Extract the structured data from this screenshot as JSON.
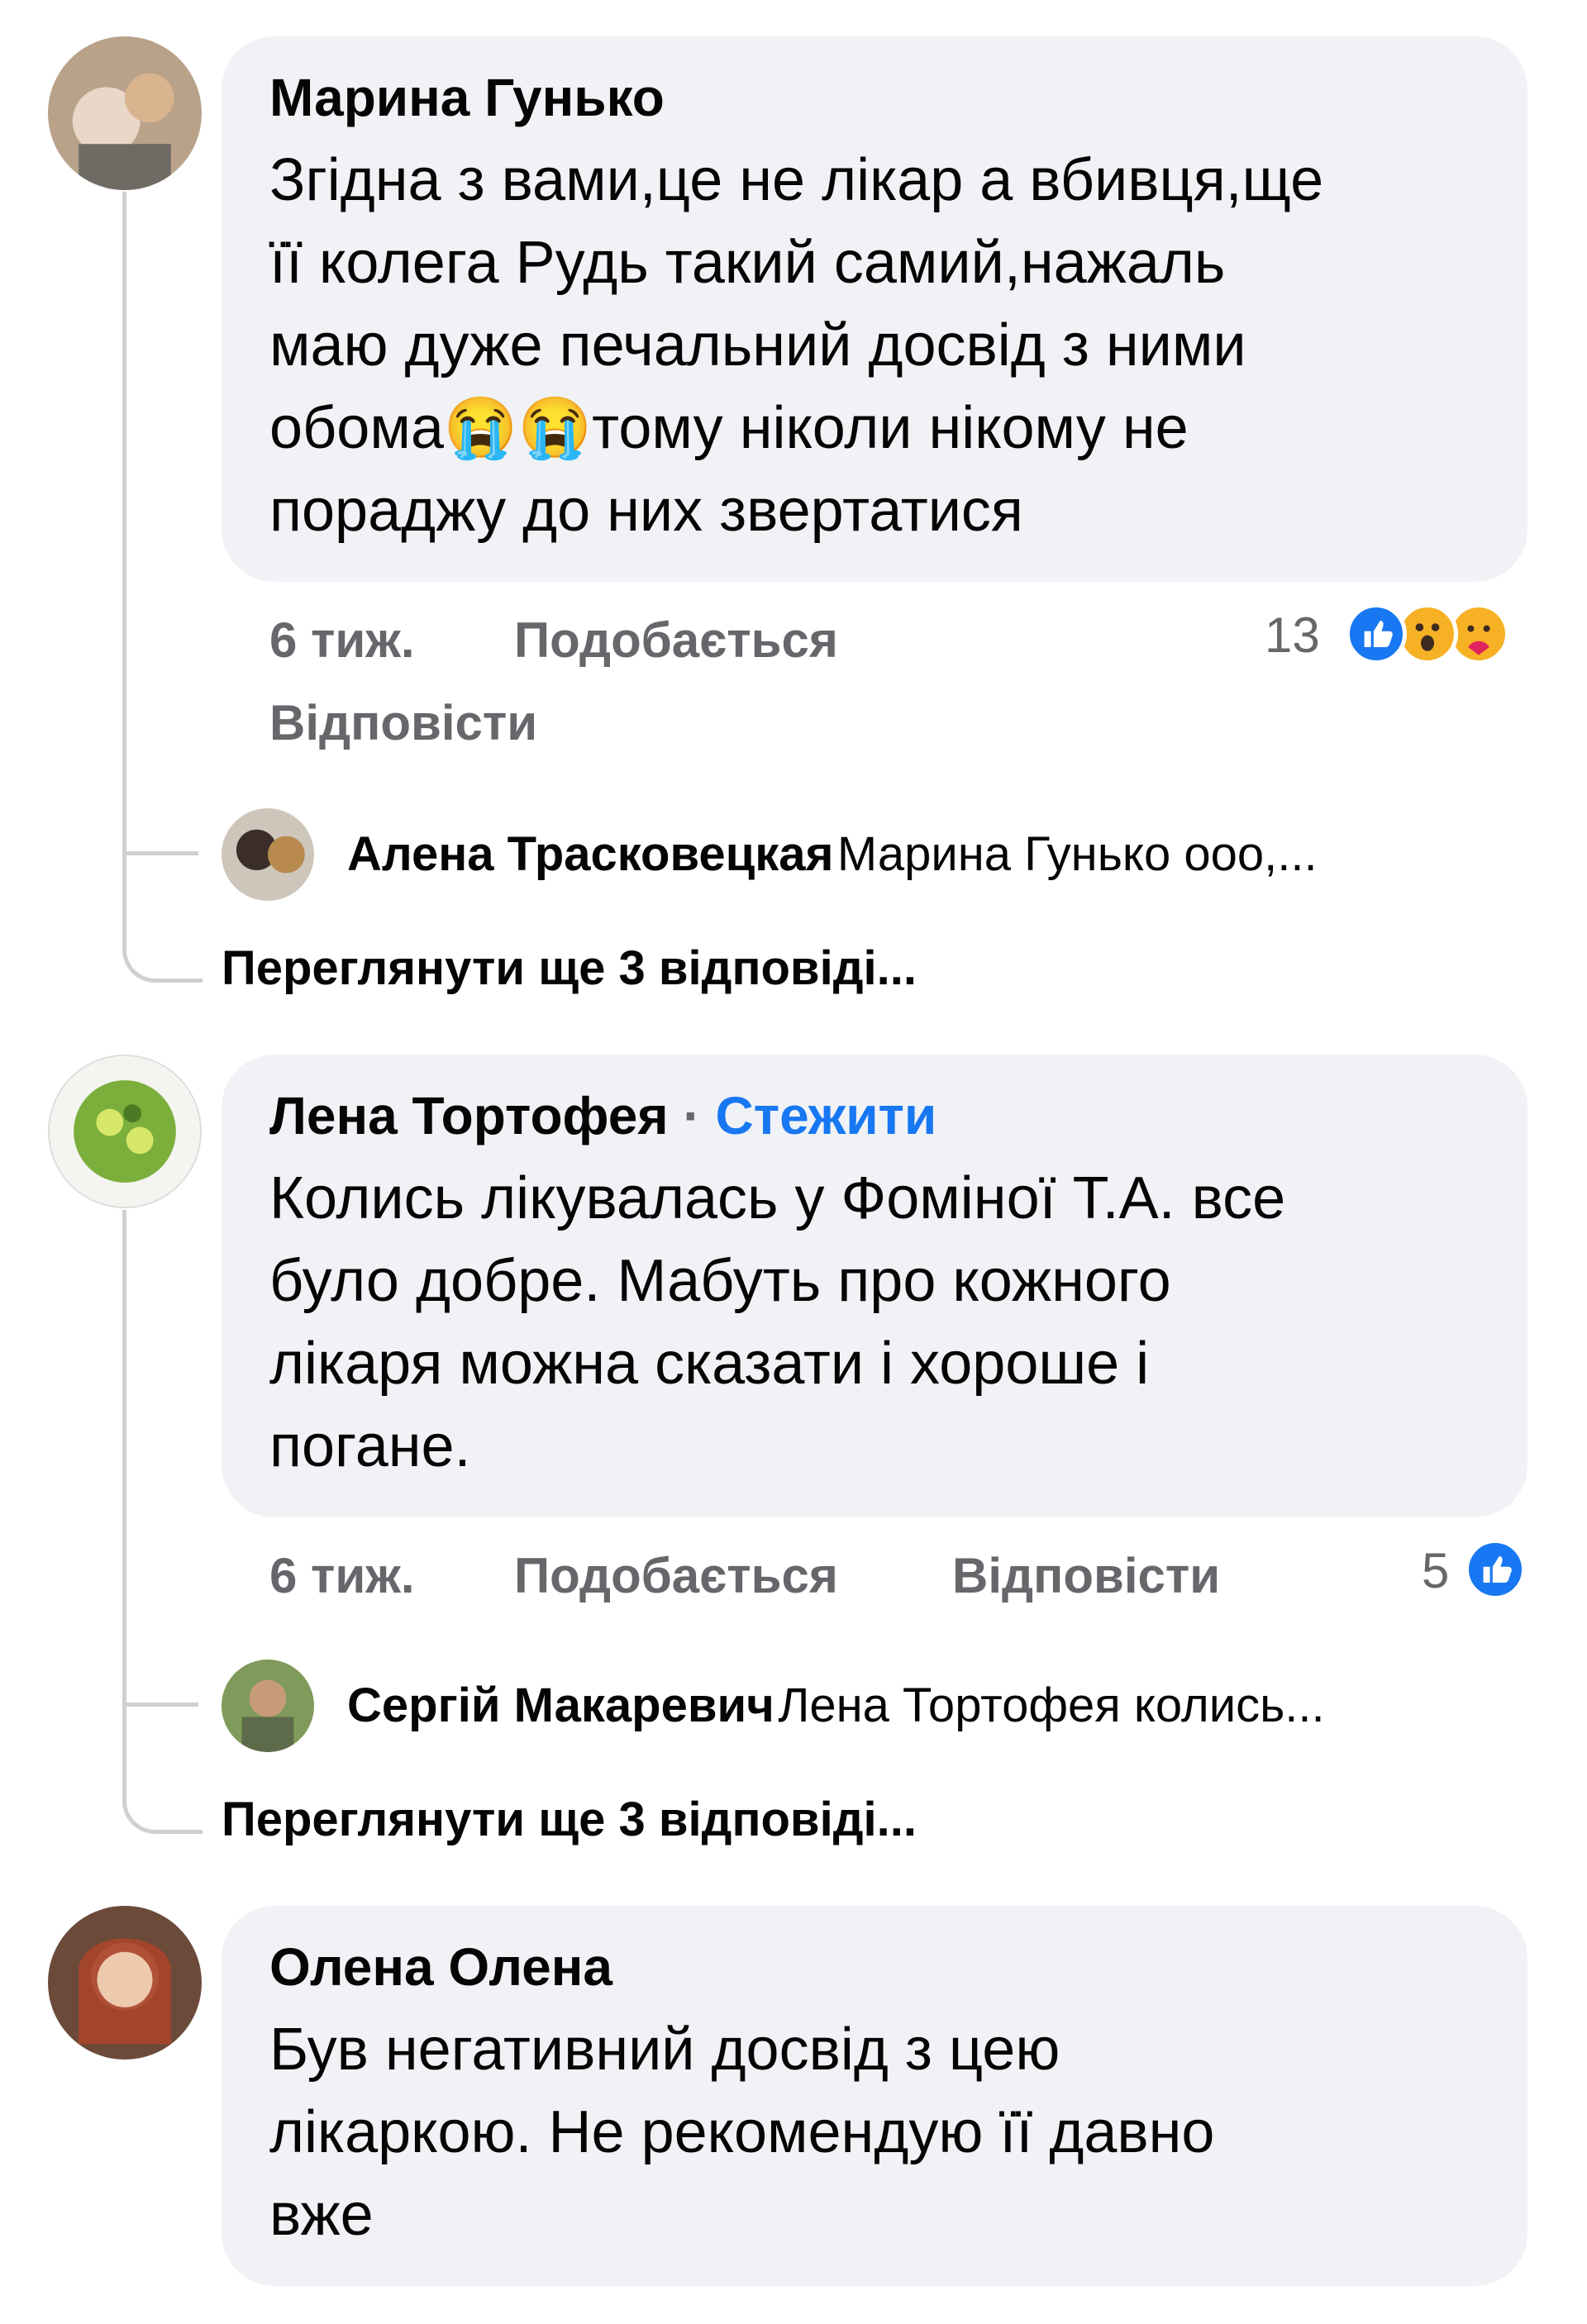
{
  "comments": [
    {
      "author": "Марина Гунько",
      "text": "Згідна з вами,це не лікар а вбивця,ще\nїї колега Рудь такий самий,нажаль\nмаю дуже печальний досвід з ними\nобома😭😭тому ніколи нікому не\nпораджу до них звертатися",
      "time": "6 тиж.",
      "like": "Подобається",
      "reply": "Відповісти",
      "reactions_count": "13",
      "reactions": [
        "like-icon",
        "wow-icon",
        "care-icon"
      ],
      "reply_preview": {
        "name": "Алена Трасковецкая",
        "text": "Марина Гунько ооо,..."
      },
      "more_replies": "Переглянути ще 3 відповіді..."
    },
    {
      "author": "Лена Тортофея",
      "follow_sep": "·",
      "follow": "Стежити",
      "text": "Колись лікувалась у Фоміної Т.А. все\nбуло добре. Мабуть про кожного\nлікаря можна сказати і хороше і\nпогане.",
      "time": "6 тиж.",
      "like": "Подобається",
      "reply": "Відповісти",
      "reactions_count": "5",
      "reactions": [
        "like-icon"
      ],
      "reply_preview": {
        "name": "Сергій Макаревич",
        "text": "Лена Тортофея колись..."
      },
      "more_replies": "Переглянути ще 3 відповіді..."
    },
    {
      "author": "Олена Олена",
      "text": "Був негативний досвід з цею\nлікаркою. Не рекомендую її давно\nвже"
    }
  ],
  "colors": {
    "bubble": "#f0f2f5",
    "meta": "#65676b",
    "link": "#1877f2",
    "like": "#1877f2"
  }
}
